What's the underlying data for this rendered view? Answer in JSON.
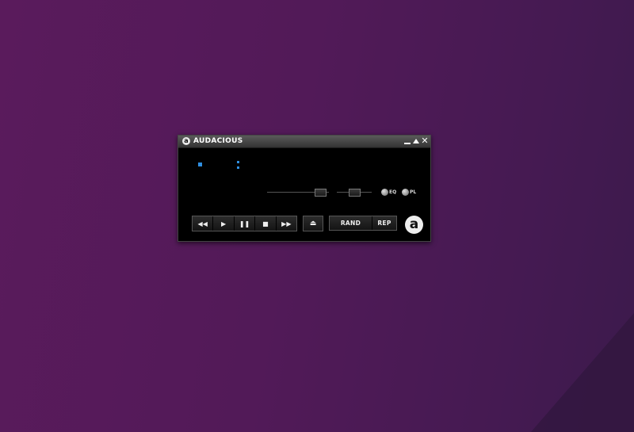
{
  "window": {
    "title": "AUDACIOUS",
    "logo_glyph": "a"
  },
  "titlebar_buttons": [
    {
      "name": "minimize",
      "icon": "minimize-icon"
    },
    {
      "name": "shade",
      "icon": "shade-icon"
    },
    {
      "name": "close",
      "icon": "close-icon",
      "glyph": "✕"
    }
  ],
  "display": {
    "status": "stopped",
    "time_text": ":",
    "accent_color": "#2f8fe0"
  },
  "toggles": {
    "eq_label": "EQ",
    "pl_label": "PL"
  },
  "transport": {
    "previous_glyph": "◀◀",
    "play_glyph": "▶",
    "pause_glyph": "❚❚",
    "stop_glyph": "■",
    "next_glyph": "▶▶",
    "eject_glyph": "⏏"
  },
  "modes": {
    "shuffle_label": "RAND",
    "repeat_label": "REP"
  },
  "about": {
    "glyph": "a"
  },
  "colors": {
    "desktop": "#521a58",
    "player_bg": "#000000",
    "accent": "#2f8fe0"
  }
}
